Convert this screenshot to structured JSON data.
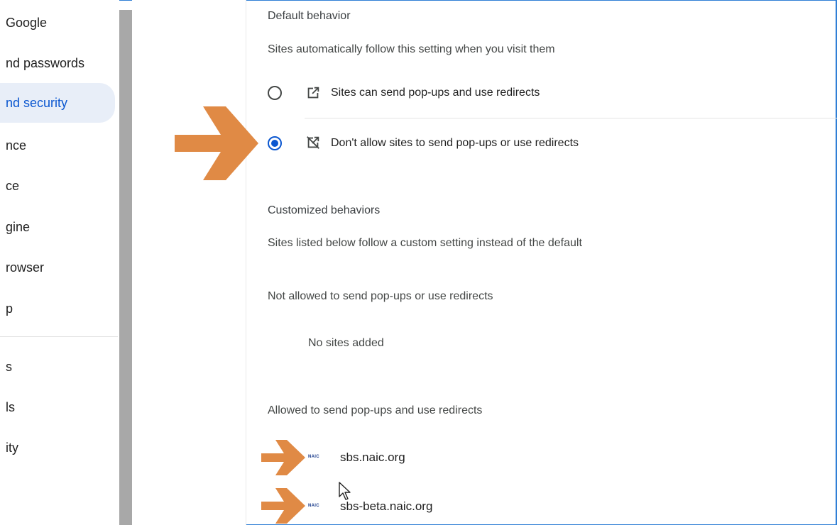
{
  "sidebar": {
    "items": [
      {
        "label": "Google"
      },
      {
        "label": "nd passwords"
      },
      {
        "label": "nd security"
      },
      {
        "label": "nce"
      },
      {
        "label": "ce"
      },
      {
        "label": "gine"
      },
      {
        "label": "rowser"
      },
      {
        "label": "p"
      },
      {
        "label": "s"
      },
      {
        "label": "ls"
      },
      {
        "label": "ity"
      }
    ]
  },
  "default_behavior": {
    "title": "Default behavior",
    "description": "Sites automatically follow this setting when you visit them",
    "options": [
      {
        "label": "Sites can send pop-ups and use redirects",
        "icon": "open-in-new-icon",
        "selected": false
      },
      {
        "label": "Don't allow sites to send pop-ups or use redirects",
        "icon": "popup-blocked-icon",
        "selected": true
      }
    ]
  },
  "customized": {
    "title": "Customized behaviors",
    "description": "Sites listed below follow a custom setting instead of the default",
    "not_allowed": {
      "title": "Not allowed to send pop-ups or use redirects",
      "empty": "No sites added"
    },
    "allowed": {
      "title": "Allowed to send pop-ups and use redirects",
      "sites": [
        {
          "logo": "NAIC",
          "name": "sbs.naic.org"
        },
        {
          "logo": "NAIC",
          "name": "sbs-beta.naic.org"
        }
      ]
    }
  },
  "colors": {
    "accent": "#0b57d0",
    "annotation_arrow": "#e08a45"
  }
}
